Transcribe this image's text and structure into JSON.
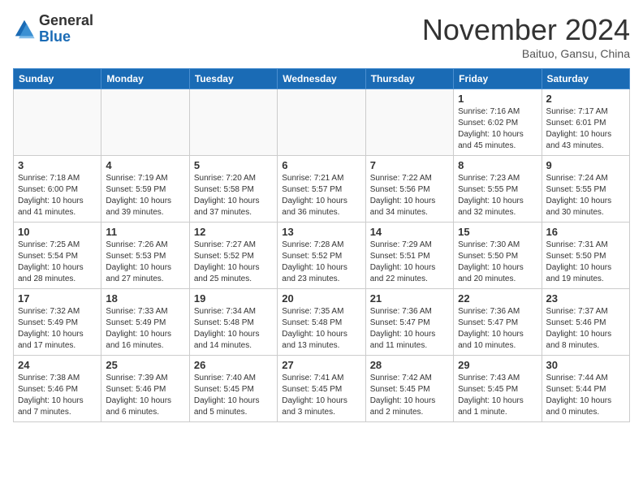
{
  "header": {
    "logo_general": "General",
    "logo_blue": "Blue",
    "month_title": "November 2024",
    "location": "Baituo, Gansu, China"
  },
  "weekdays": [
    "Sunday",
    "Monday",
    "Tuesday",
    "Wednesday",
    "Thursday",
    "Friday",
    "Saturday"
  ],
  "weeks": [
    [
      {
        "day": "",
        "info": ""
      },
      {
        "day": "",
        "info": ""
      },
      {
        "day": "",
        "info": ""
      },
      {
        "day": "",
        "info": ""
      },
      {
        "day": "",
        "info": ""
      },
      {
        "day": "1",
        "info": "Sunrise: 7:16 AM\nSunset: 6:02 PM\nDaylight: 10 hours\nand 45 minutes."
      },
      {
        "day": "2",
        "info": "Sunrise: 7:17 AM\nSunset: 6:01 PM\nDaylight: 10 hours\nand 43 minutes."
      }
    ],
    [
      {
        "day": "3",
        "info": "Sunrise: 7:18 AM\nSunset: 6:00 PM\nDaylight: 10 hours\nand 41 minutes."
      },
      {
        "day": "4",
        "info": "Sunrise: 7:19 AM\nSunset: 5:59 PM\nDaylight: 10 hours\nand 39 minutes."
      },
      {
        "day": "5",
        "info": "Sunrise: 7:20 AM\nSunset: 5:58 PM\nDaylight: 10 hours\nand 37 minutes."
      },
      {
        "day": "6",
        "info": "Sunrise: 7:21 AM\nSunset: 5:57 PM\nDaylight: 10 hours\nand 36 minutes."
      },
      {
        "day": "7",
        "info": "Sunrise: 7:22 AM\nSunset: 5:56 PM\nDaylight: 10 hours\nand 34 minutes."
      },
      {
        "day": "8",
        "info": "Sunrise: 7:23 AM\nSunset: 5:55 PM\nDaylight: 10 hours\nand 32 minutes."
      },
      {
        "day": "9",
        "info": "Sunrise: 7:24 AM\nSunset: 5:55 PM\nDaylight: 10 hours\nand 30 minutes."
      }
    ],
    [
      {
        "day": "10",
        "info": "Sunrise: 7:25 AM\nSunset: 5:54 PM\nDaylight: 10 hours\nand 28 minutes."
      },
      {
        "day": "11",
        "info": "Sunrise: 7:26 AM\nSunset: 5:53 PM\nDaylight: 10 hours\nand 27 minutes."
      },
      {
        "day": "12",
        "info": "Sunrise: 7:27 AM\nSunset: 5:52 PM\nDaylight: 10 hours\nand 25 minutes."
      },
      {
        "day": "13",
        "info": "Sunrise: 7:28 AM\nSunset: 5:52 PM\nDaylight: 10 hours\nand 23 minutes."
      },
      {
        "day": "14",
        "info": "Sunrise: 7:29 AM\nSunset: 5:51 PM\nDaylight: 10 hours\nand 22 minutes."
      },
      {
        "day": "15",
        "info": "Sunrise: 7:30 AM\nSunset: 5:50 PM\nDaylight: 10 hours\nand 20 minutes."
      },
      {
        "day": "16",
        "info": "Sunrise: 7:31 AM\nSunset: 5:50 PM\nDaylight: 10 hours\nand 19 minutes."
      }
    ],
    [
      {
        "day": "17",
        "info": "Sunrise: 7:32 AM\nSunset: 5:49 PM\nDaylight: 10 hours\nand 17 minutes."
      },
      {
        "day": "18",
        "info": "Sunrise: 7:33 AM\nSunset: 5:49 PM\nDaylight: 10 hours\nand 16 minutes."
      },
      {
        "day": "19",
        "info": "Sunrise: 7:34 AM\nSunset: 5:48 PM\nDaylight: 10 hours\nand 14 minutes."
      },
      {
        "day": "20",
        "info": "Sunrise: 7:35 AM\nSunset: 5:48 PM\nDaylight: 10 hours\nand 13 minutes."
      },
      {
        "day": "21",
        "info": "Sunrise: 7:36 AM\nSunset: 5:47 PM\nDaylight: 10 hours\nand 11 minutes."
      },
      {
        "day": "22",
        "info": "Sunrise: 7:36 AM\nSunset: 5:47 PM\nDaylight: 10 hours\nand 10 minutes."
      },
      {
        "day": "23",
        "info": "Sunrise: 7:37 AM\nSunset: 5:46 PM\nDaylight: 10 hours\nand 8 minutes."
      }
    ],
    [
      {
        "day": "24",
        "info": "Sunrise: 7:38 AM\nSunset: 5:46 PM\nDaylight: 10 hours\nand 7 minutes."
      },
      {
        "day": "25",
        "info": "Sunrise: 7:39 AM\nSunset: 5:46 PM\nDaylight: 10 hours\nand 6 minutes."
      },
      {
        "day": "26",
        "info": "Sunrise: 7:40 AM\nSunset: 5:45 PM\nDaylight: 10 hours\nand 5 minutes."
      },
      {
        "day": "27",
        "info": "Sunrise: 7:41 AM\nSunset: 5:45 PM\nDaylight: 10 hours\nand 3 minutes."
      },
      {
        "day": "28",
        "info": "Sunrise: 7:42 AM\nSunset: 5:45 PM\nDaylight: 10 hours\nand 2 minutes."
      },
      {
        "day": "29",
        "info": "Sunrise: 7:43 AM\nSunset: 5:45 PM\nDaylight: 10 hours\nand 1 minute."
      },
      {
        "day": "30",
        "info": "Sunrise: 7:44 AM\nSunset: 5:44 PM\nDaylight: 10 hours\nand 0 minutes."
      }
    ]
  ]
}
